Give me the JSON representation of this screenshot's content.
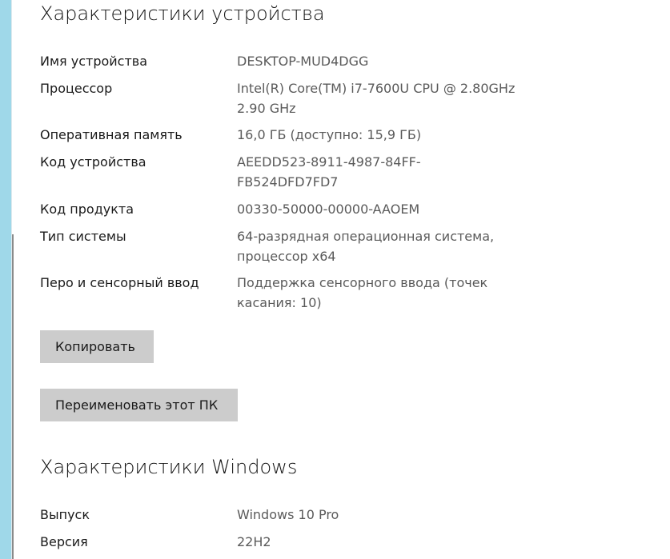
{
  "device_specs": {
    "title": "Характеристики устройства",
    "rows": [
      {
        "label": "Имя устройства",
        "value": "DESKTOP-MUD4DGG"
      },
      {
        "label": "Процессор",
        "value": "Intel(R) Core(TM) i7-7600U CPU @ 2.80GHz\n2.90 GHz"
      },
      {
        "label": "Оперативная память",
        "value": "16,0 ГБ (доступно: 15,9 ГБ)"
      },
      {
        "label": "Код устройства",
        "value": "AEEDD523-8911-4987-84FF-\nFB524DFD7FD7"
      },
      {
        "label": "Код продукта",
        "value": "00330-50000-00000-AAOEM"
      },
      {
        "label": "Тип системы",
        "value": "64-разрядная операционная система,\nпроцессор x64"
      },
      {
        "label": "Перо и сенсорный ввод",
        "value": "Поддержка сенсорного ввода (точек\nкасания: 10)"
      }
    ],
    "copy_button": "Копировать",
    "rename_button": "Переименовать этот ПК"
  },
  "windows_specs": {
    "title": "Характеристики Windows",
    "rows": [
      {
        "label": "Выпуск",
        "value": "Windows 10 Pro"
      },
      {
        "label": "Версия",
        "value": "22H2"
      }
    ]
  },
  "colors": {
    "left_strip": "#9fd8e9",
    "button_bg": "#cccccc",
    "value_text": "#5a5a5a"
  }
}
